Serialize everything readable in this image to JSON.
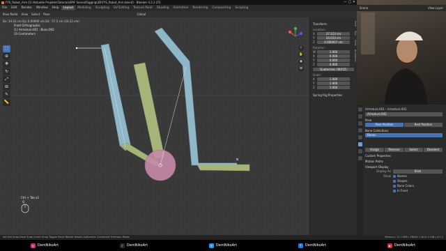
{
  "window": {
    "title": "FYS_Robot_Arm [G:\\Aktuelle Projekte\\Tutorials\\PAF Series\\Rigging\\3D\\FYS_Robot_Arm.blend] - Blender 4.2.2 LTS",
    "controls": "—  ▢  ✕"
  },
  "menubar": {
    "items": [
      "File",
      "Edit",
      "Render",
      "Window",
      "Help"
    ],
    "workspaces": [
      "Layout",
      "Modeling",
      "Sculpting",
      "UV Editing",
      "Texture Paint",
      "Shading",
      "Animation",
      "Rendering",
      "Compositing",
      "Scripting"
    ],
    "active_workspace": "Layout"
  },
  "toolheader": {
    "mode": "Pose Mode",
    "menus": [
      "View",
      "Select",
      "Pose"
    ],
    "orientation": "Global",
    "readout": "Dx: 24.03 cm   Dy: 0.00000 cm   Dz: -57.5 cm (24.22 cm)"
  },
  "viewport_overlay": {
    "view_name": "Front Orthographic",
    "object": "(1) Armature.001 : Bone.002",
    "scale": "10 Centimeters",
    "shortcut": "Ctrl + Tab x2",
    "shortcut_key": "Q"
  },
  "toolbar_icons": [
    "select-box-icon",
    "cursor-icon",
    "move-icon",
    "rotate-icon",
    "scale-icon",
    "transform-icon",
    "annotate-icon",
    "measure-icon"
  ],
  "npanel": {
    "header": "Transform",
    "location_label": "Location:",
    "location": [
      [
        "X",
        "27.223 cm"
      ],
      [
        "Y",
        "24.033 cm"
      ],
      [
        "Z",
        "0.000007 cm"
      ]
    ],
    "rotation_label": "Rotation:",
    "rotation": [
      [
        "W",
        "1.000"
      ],
      [
        "X",
        "0.000"
      ],
      [
        "Y",
        "0.000"
      ],
      [
        "Z",
        "0.000"
      ]
    ],
    "rotation_mode": "Quaternion (WXYZ)",
    "scale_label": "Scale:",
    "scale": [
      [
        "X",
        "1.000"
      ],
      [
        "Y",
        "1.000"
      ],
      [
        "Z",
        "1.000"
      ]
    ],
    "footer": "Spring Rig Properties",
    "tabs": [
      "Item",
      "Tool",
      "View",
      "Animation"
    ]
  },
  "webcam": {
    "scene": "Scene",
    "view_layer": "View Layer"
  },
  "properties": {
    "breadcrumb": "Armature.001  ›  Armature.002",
    "name": "Armature.002",
    "pose_section": "Pose",
    "pose_buttons": [
      "Pose Position",
      "Rest Position"
    ],
    "bone_collections": "Bone Collections",
    "collection_item": "Bones",
    "collection_buttons": [
      "Assign",
      "Remove",
      "Select",
      "Deselect"
    ],
    "custom_properties": "Custom Properties",
    "motion_paths": "Motion Paths",
    "viewport_display": "Viewport Display",
    "display_as_label": "Display As",
    "display_as": "Stick",
    "show_label": "Show",
    "show_items": [
      "Names",
      "Shapes",
      "Bone Colors",
      "In Front"
    ]
  },
  "statusbar": {
    "hints": "Set   Set Snap Base   Snap Invert   Snap Toggle   Move   Rotate   Resize   Automatic Constraint   Precision Mode",
    "version": "Memory: 72.1 MiB | VRAM: 1.6/12.0 GiB | 4.2.2"
  },
  "social": [
    {
      "icon": "instagram-icon",
      "handle": "DemNikoArt",
      "color": "#d6247a"
    },
    {
      "icon": "tiktok-icon",
      "handle": "DemNikoArt",
      "color": "#2b2b2b"
    },
    {
      "icon": "twitter-icon",
      "handle": "DemNikoArt",
      "color": "#1d9bf0"
    },
    {
      "icon": "facebook-icon",
      "handle": "DemNikoArt",
      "color": "#1877f2"
    },
    {
      "icon": "youtube-icon",
      "handle": "DemNikoArt",
      "color": "#e02424"
    }
  ],
  "colors": {
    "bone_blue": "#8fb7c7",
    "bone_green": "#a5b57a",
    "bone_pink": "#c78aa9",
    "accent": "#4772b3"
  }
}
